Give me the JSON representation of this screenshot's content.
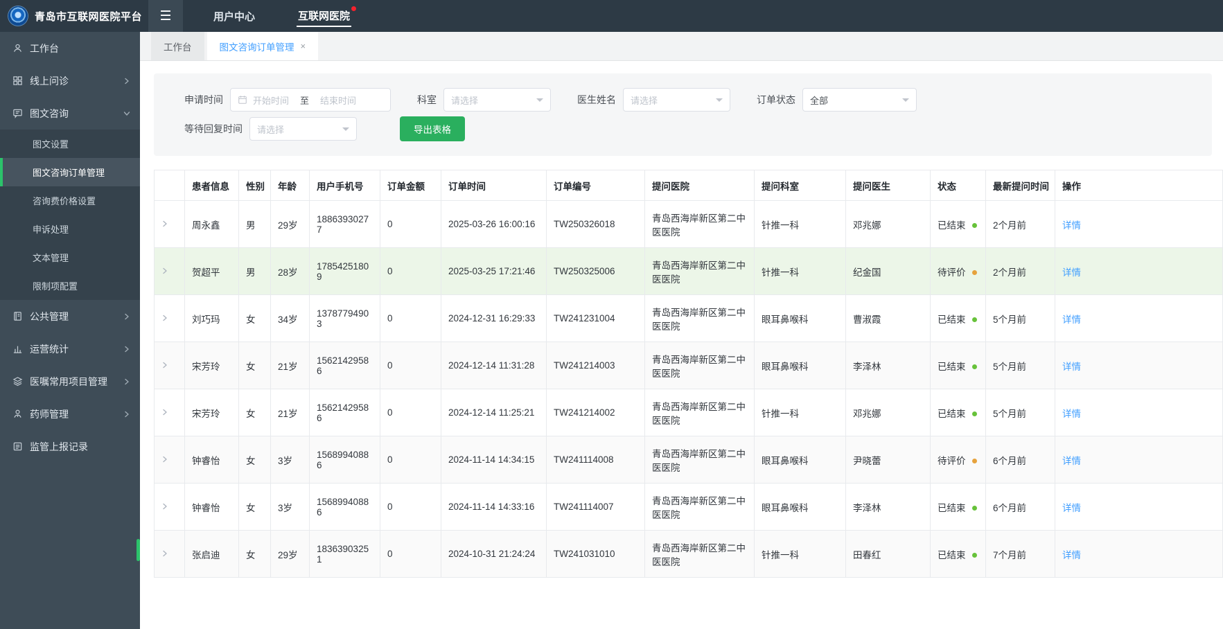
{
  "colors": {
    "accent": "#409eff",
    "green_button": "#2aaf5e",
    "status_finished": "#67c23a",
    "status_pending": "#e6a23c",
    "active_menu_bar": "#2cc36b",
    "row_highlight": "#ecf6e8",
    "badge_red": "#f5222d"
  },
  "header": {
    "app_title": "青岛市互联网医院平台",
    "menu_icon": "hamburger-icon",
    "nav": [
      {
        "label": "用户中心",
        "active": false,
        "badge": false
      },
      {
        "label": "互联网医院",
        "active": true,
        "badge": true
      }
    ]
  },
  "sidebar": {
    "items": [
      {
        "label": "工作台",
        "icon": "workbench-icon"
      },
      {
        "label": "线上问诊",
        "icon": "grid-icon",
        "chevron": "right"
      },
      {
        "label": "图文咨询",
        "icon": "chat-icon",
        "chevron": "down",
        "expanded": true,
        "children": [
          {
            "label": "图文设置",
            "active": false
          },
          {
            "label": "图文咨询订单管理",
            "active": true
          },
          {
            "label": "咨询费价格设置",
            "active": false
          },
          {
            "label": "申诉处理",
            "active": false
          },
          {
            "label": "文本管理",
            "active": false
          },
          {
            "label": "限制项配置",
            "active": false
          }
        ]
      },
      {
        "label": "公共管理",
        "icon": "book-icon",
        "chevron": "right"
      },
      {
        "label": "运营统计",
        "icon": "chart-icon",
        "chevron": "right"
      },
      {
        "label": "医嘱常用项目管理",
        "icon": "layers-icon",
        "chevron": "right"
      },
      {
        "label": "药师管理",
        "icon": "pharmacist-icon",
        "chevron": "right"
      },
      {
        "label": "监管上报记录",
        "icon": "report-icon"
      }
    ]
  },
  "tabs": [
    {
      "label": "工作台",
      "active": false,
      "closable": false
    },
    {
      "label": "图文咨询订单管理",
      "active": true,
      "closable": true
    }
  ],
  "filters": {
    "apply_time": {
      "label": "申请时间",
      "icon": "calendar-icon",
      "start_placeholder": "开始时间",
      "separator": "至",
      "end_placeholder": "结束时间"
    },
    "department": {
      "label": "科室",
      "placeholder": "请选择"
    },
    "doctor_name": {
      "label": "医生姓名",
      "placeholder": "请选择"
    },
    "order_status": {
      "label": "订单状态",
      "value": "全部"
    },
    "wait_reply_time": {
      "label": "等待回复时间",
      "placeholder": "请选择"
    },
    "export_button": "导出表格"
  },
  "table": {
    "headers": [
      "",
      "患者信息",
      "性别",
      "年龄",
      "用户手机号",
      "订单金额",
      "订单时间",
      "订单编号",
      "提问医院",
      "提问科室",
      "提问医生",
      "状态",
      "最新提问时间",
      "操作"
    ],
    "action_label": "详情",
    "rows": [
      {
        "patient": "周永鑫",
        "gender": "男",
        "age": "29岁",
        "phone": "18863930277",
        "amount": "0",
        "order_time": "2025-03-26 16:00:16",
        "order_no": "TW250326018",
        "hospital": "青岛西海岸新区第二中医医院",
        "dept": "针推一科",
        "doctor": "邓兆娜",
        "status": "已结束",
        "status_color": "#67c23a",
        "latest": "2个月前",
        "highlight": false
      },
      {
        "patient": "贺超平",
        "gender": "男",
        "age": "28岁",
        "phone": "17854251809",
        "amount": "0",
        "order_time": "2025-03-25 17:21:46",
        "order_no": "TW250325006",
        "hospital": "青岛西海岸新区第二中医医院",
        "dept": "针推一科",
        "doctor": "纪金国",
        "status": "待评价",
        "status_color": "#e6a23c",
        "latest": "2个月前",
        "highlight": true
      },
      {
        "patient": "刘巧玛",
        "gender": "女",
        "age": "34岁",
        "phone": "13787794903",
        "amount": "0",
        "order_time": "2024-12-31 16:29:33",
        "order_no": "TW241231004",
        "hospital": "青岛西海岸新区第二中医医院",
        "dept": "眼耳鼻喉科",
        "doctor": "曹淑霞",
        "status": "已结束",
        "status_color": "#67c23a",
        "latest": "5个月前",
        "highlight": false
      },
      {
        "patient": "宋芳玲",
        "gender": "女",
        "age": "21岁",
        "phone": "15621429586",
        "amount": "0",
        "order_time": "2024-12-14 11:31:28",
        "order_no": "TW241214003",
        "hospital": "青岛西海岸新区第二中医医院",
        "dept": "眼耳鼻喉科",
        "doctor": "李泽林",
        "status": "已结束",
        "status_color": "#67c23a",
        "latest": "5个月前",
        "highlight": false
      },
      {
        "patient": "宋芳玲",
        "gender": "女",
        "age": "21岁",
        "phone": "15621429586",
        "amount": "0",
        "order_time": "2024-12-14 11:25:21",
        "order_no": "TW241214002",
        "hospital": "青岛西海岸新区第二中医医院",
        "dept": "针推一科",
        "doctor": "邓兆娜",
        "status": "已结束",
        "status_color": "#67c23a",
        "latest": "5个月前",
        "highlight": false
      },
      {
        "patient": "钟睿怡",
        "gender": "女",
        "age": "3岁",
        "phone": "15689940886",
        "amount": "0",
        "order_time": "2024-11-14 14:34:15",
        "order_no": "TW241114008",
        "hospital": "青岛西海岸新区第二中医医院",
        "dept": "眼耳鼻喉科",
        "doctor": "尹晓蕾",
        "status": "待评价",
        "status_color": "#e6a23c",
        "latest": "6个月前",
        "highlight": false
      },
      {
        "patient": "钟睿怡",
        "gender": "女",
        "age": "3岁",
        "phone": "15689940886",
        "amount": "0",
        "order_time": "2024-11-14 14:33:16",
        "order_no": "TW241114007",
        "hospital": "青岛西海岸新区第二中医医院",
        "dept": "眼耳鼻喉科",
        "doctor": "李泽林",
        "status": "已结束",
        "status_color": "#67c23a",
        "latest": "6个月前",
        "highlight": false
      },
      {
        "patient": "张启迪",
        "gender": "女",
        "age": "29岁",
        "phone": "18363903251",
        "amount": "0",
        "order_time": "2024-10-31 21:24:24",
        "order_no": "TW241031010",
        "hospital": "青岛西海岸新区第二中医医院",
        "dept": "针推一科",
        "doctor": "田春红",
        "status": "已结束",
        "status_color": "#67c23a",
        "latest": "7个月前",
        "highlight": false
      }
    ]
  }
}
